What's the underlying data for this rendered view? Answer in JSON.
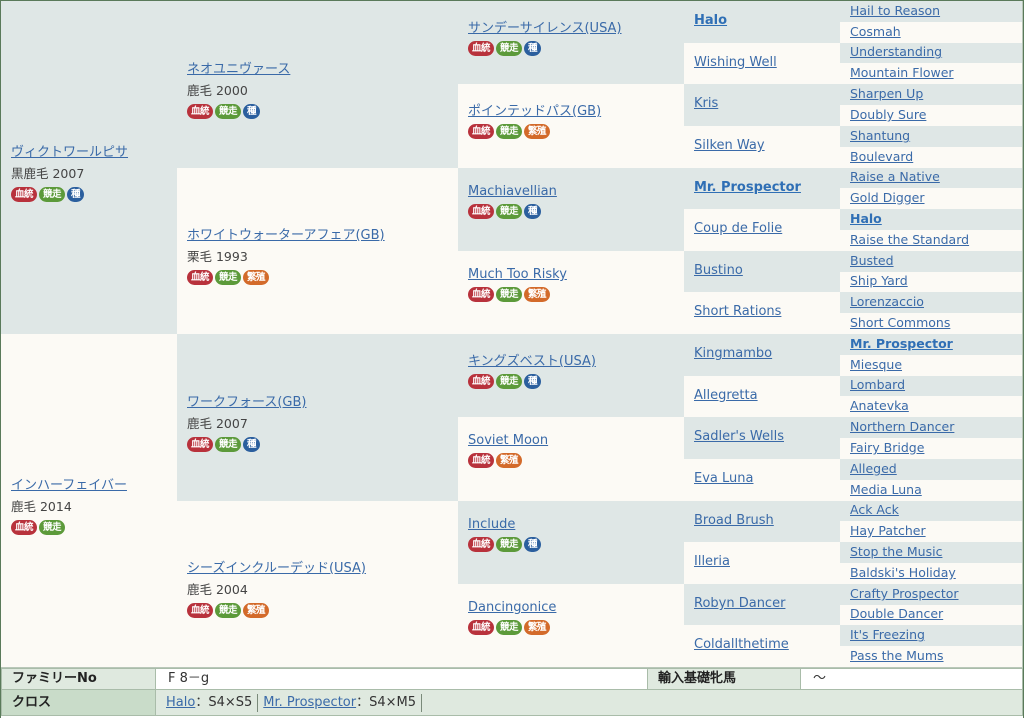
{
  "generations": {
    "g1": [
      {
        "name": "ヴィクトワールピサ",
        "info": "黒鹿毛 2007",
        "badges": [
          "血統",
          "競走",
          "種"
        ]
      },
      {
        "name": "インハーフェイバー",
        "info": "鹿毛 2014",
        "badges": [
          "血統",
          "競走"
        ]
      }
    ],
    "g2": [
      {
        "name": "ネオユニヴァース",
        "info": "鹿毛 2000",
        "badges": [
          "血統",
          "競走",
          "種"
        ]
      },
      {
        "name": "ホワイトウォーターアフェア(GB)",
        "info": "栗毛 1993",
        "badges": [
          "血統",
          "競走",
          "繁殖"
        ]
      },
      {
        "name": "ワークフォース(GB)",
        "info": "鹿毛 2007",
        "badges": [
          "血統",
          "競走",
          "種"
        ]
      },
      {
        "name": "シーズインクルーデッド(USA)",
        "info": "鹿毛 2004",
        "badges": [
          "血統",
          "競走",
          "繁殖"
        ]
      }
    ],
    "g3": [
      {
        "name": "サンデーサイレンス(USA)",
        "badges": [
          "血統",
          "競走",
          "種"
        ]
      },
      {
        "name": "ポインテッドパス(GB)",
        "badges": [
          "血統",
          "競走",
          "繁殖"
        ]
      },
      {
        "name": "Machiavellian",
        "badges": [
          "血統",
          "競走",
          "種"
        ]
      },
      {
        "name": "Much Too Risky",
        "badges": [
          "血統",
          "競走",
          "繁殖"
        ]
      },
      {
        "name": "キングズベスト(USA)",
        "badges": [
          "血統",
          "競走",
          "種"
        ]
      },
      {
        "name": "Soviet Moon",
        "badges": [
          "血統",
          "繁殖"
        ]
      },
      {
        "name": "Include",
        "badges": [
          "血統",
          "競走",
          "種"
        ]
      },
      {
        "name": "Dancingonice",
        "badges": [
          "血統",
          "競走",
          "繁殖"
        ]
      }
    ],
    "g4": [
      {
        "name": "Halo",
        "bold": true
      },
      {
        "name": "Wishing Well"
      },
      {
        "name": "Kris"
      },
      {
        "name": "Silken Way"
      },
      {
        "name": "Mr. Prospector",
        "bold": true
      },
      {
        "name": "Coup de Folie"
      },
      {
        "name": "Bustino"
      },
      {
        "name": "Short Rations"
      },
      {
        "name": "Kingmambo"
      },
      {
        "name": "Allegretta"
      },
      {
        "name": "Sadler's Wells"
      },
      {
        "name": "Eva Luna"
      },
      {
        "name": "Broad Brush"
      },
      {
        "name": "Illeria"
      },
      {
        "name": "Robyn Dancer"
      },
      {
        "name": "Coldallthetime"
      }
    ],
    "g5": [
      {
        "name": "Hail to Reason"
      },
      {
        "name": "Cosmah"
      },
      {
        "name": "Understanding"
      },
      {
        "name": "Mountain Flower"
      },
      {
        "name": "Sharpen Up"
      },
      {
        "name": "Doubly Sure"
      },
      {
        "name": "Shantung"
      },
      {
        "name": "Boulevard"
      },
      {
        "name": "Raise a Native"
      },
      {
        "name": "Gold Digger"
      },
      {
        "name": "Halo",
        "bold": true
      },
      {
        "name": "Raise the Standard"
      },
      {
        "name": "Busted"
      },
      {
        "name": "Ship Yard"
      },
      {
        "name": "Lorenzaccio"
      },
      {
        "name": "Short Commons"
      },
      {
        "name": "Mr. Prospector",
        "bold": true
      },
      {
        "name": "Miesque"
      },
      {
        "name": "Lombard"
      },
      {
        "name": "Anatevka"
      },
      {
        "name": "Northern Dancer"
      },
      {
        "name": "Fairy Bridge"
      },
      {
        "name": "Alleged"
      },
      {
        "name": "Media Luna"
      },
      {
        "name": "Ack Ack"
      },
      {
        "name": "Hay Patcher"
      },
      {
        "name": "Stop the Music"
      },
      {
        "name": "Baldski's Holiday"
      },
      {
        "name": "Crafty Prospector"
      },
      {
        "name": "Double Dancer"
      },
      {
        "name": "It's Freezing"
      },
      {
        "name": "Pass the Mums"
      }
    ]
  },
  "badge_colors": {
    "血統": "#b8323c",
    "競走": "#5c9a3a",
    "種": "#2b5f9e",
    "繁殖": "#d36a2a"
  },
  "info": {
    "family_label": "ファミリーNo",
    "family_value": "F 8－g",
    "import_label": "輸入基礎牝馬",
    "import_value": "～",
    "cross_label": "クロス",
    "crosses": [
      {
        "name": "Halo",
        "value": "：S4×S5"
      },
      {
        "name": "Mr. Prospector",
        "value": "：S4×M5"
      }
    ]
  }
}
